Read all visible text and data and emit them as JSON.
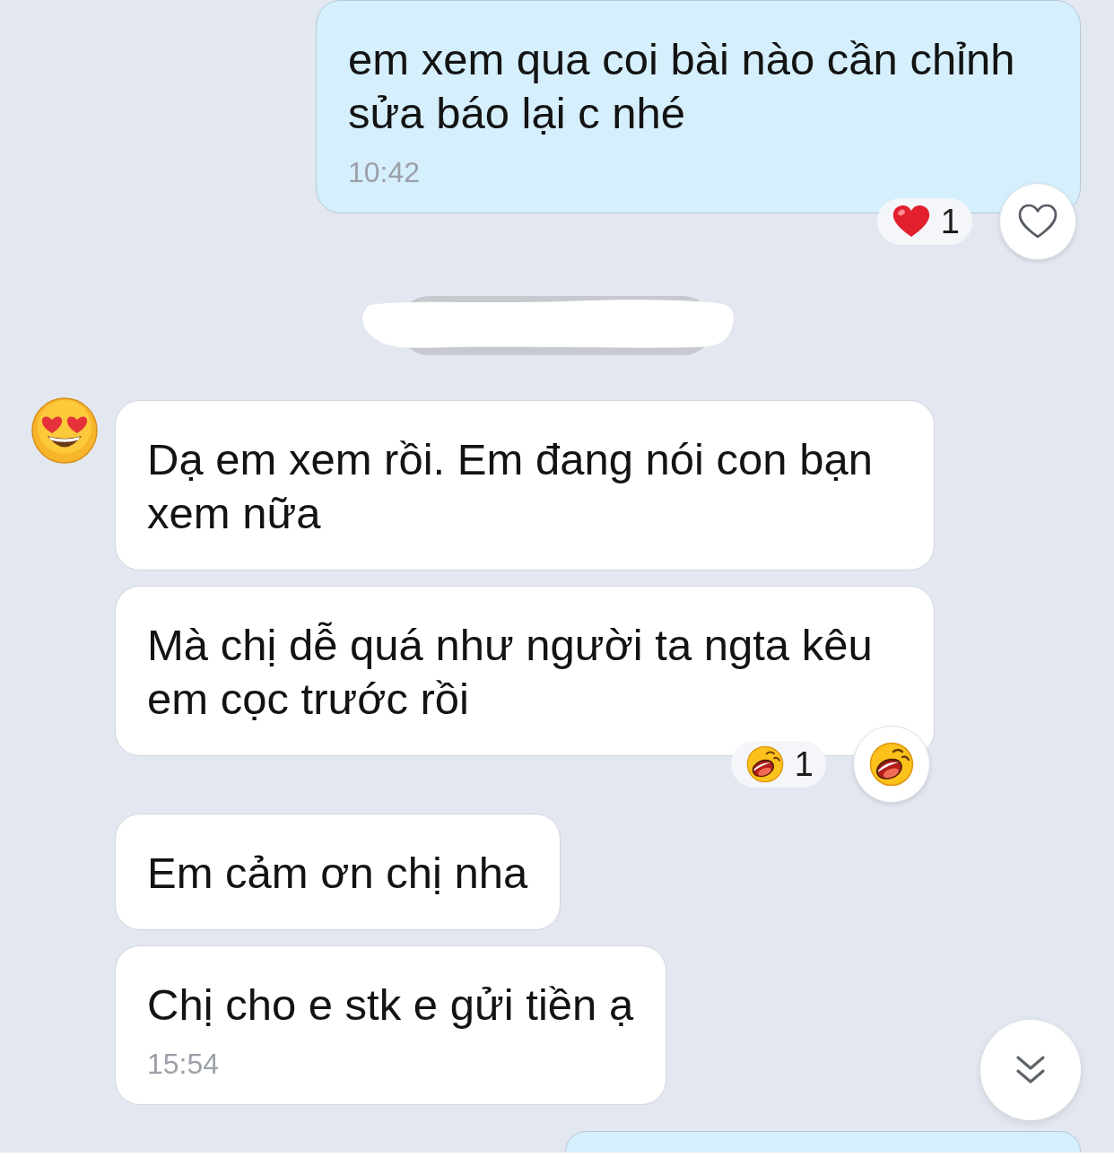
{
  "messages": [
    {
      "kind": "sent",
      "text": "em xem qua coi bài nào cần chỉnh sửa báo lại c nhé",
      "time": "10:42",
      "reaction": {
        "kind": "heart",
        "count": "1"
      },
      "react_button": {
        "kind": "empty"
      }
    },
    {
      "kind": "redacted"
    },
    {
      "kind": "received",
      "avatar": true,
      "text": "Dạ em xem rồi. Em đang nói con bạn xem nữa"
    },
    {
      "kind": "received",
      "avatar": false,
      "text": "Mà chị dễ quá như người ta ngta kêu em cọc trước rồi",
      "reaction": {
        "kind": "laugh",
        "count": "1"
      },
      "react_button": {
        "kind": "laugh"
      }
    },
    {
      "kind": "received",
      "avatar": false,
      "text": "Em cảm ơn chị nha"
    },
    {
      "kind": "received",
      "avatar": false,
      "text": "Chị cho e stk e gửi tiền ạ",
      "time": "15:54"
    },
    {
      "kind": "clipped"
    }
  ],
  "scroll_down_button": true
}
